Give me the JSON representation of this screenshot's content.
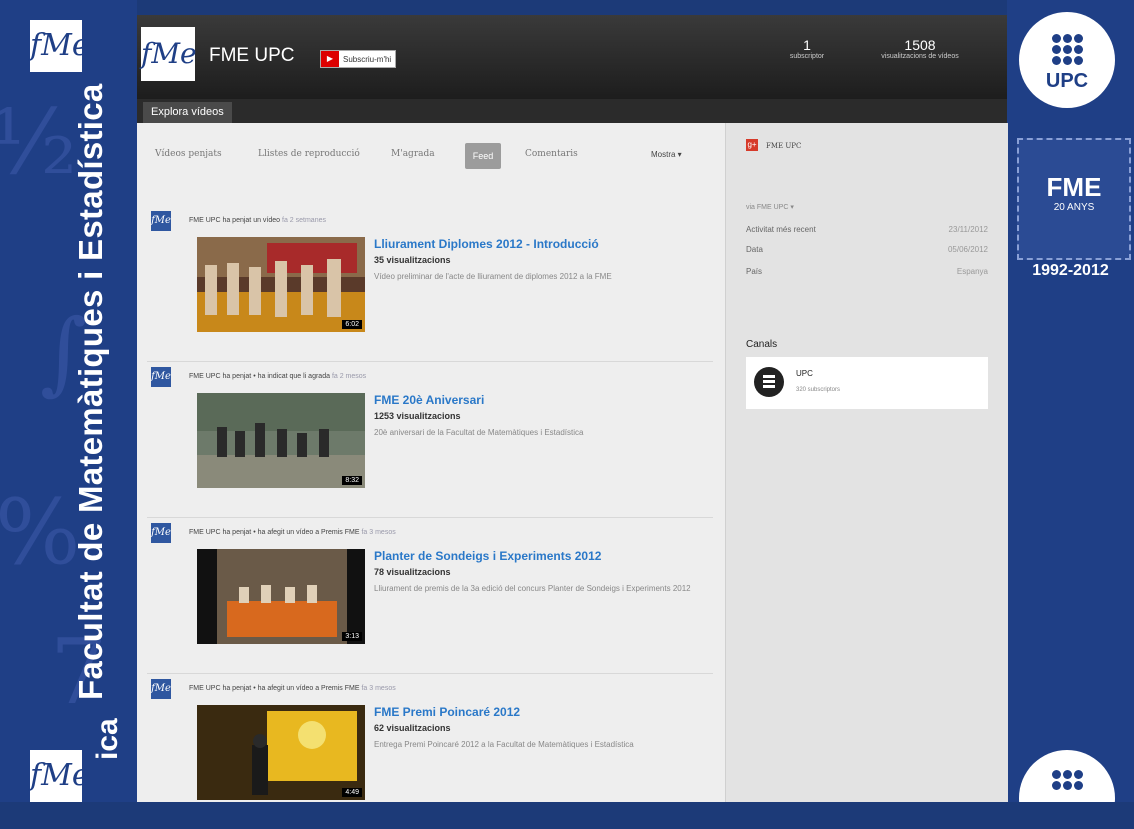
{
  "left_banner": {
    "logo_text": "fMe",
    "vertical_title": "Facultat de Matemàtiques i Estadística",
    "bottom_fragment": "ica"
  },
  "right_banner": {
    "upc_label": "UPC",
    "fme20_title": "FME",
    "fme20_sub": "20 ANYS",
    "years": "1992-2012"
  },
  "header": {
    "logo_text": "fMe",
    "channel_name": "FME UPC",
    "subscribe_label": "Subscriu-m'hi",
    "stats": [
      {
        "num": "1",
        "label": "subscriptor"
      },
      {
        "num": "1508",
        "label": "visualitzacions de vídeos"
      }
    ]
  },
  "tabs": {
    "explore": "Explora vídeos"
  },
  "subnav": {
    "items": [
      "Vídeos penjats",
      "Llistes de reproducció",
      "M'agrada",
      "Feed",
      "Comentaris"
    ],
    "show_label": "Mostra ▾"
  },
  "feed": [
    {
      "activity": "FME UPC ha penjat un vídeo",
      "ago": "fa 2 setmanes",
      "title": "Lliurament Diplomes 2012 - Introducció",
      "views": "35 visualitzacions",
      "desc": "Vídeo preliminar de l'acte de lliurament de diplomes 2012 a la FME",
      "duration": "6:02"
    },
    {
      "activity": "FME UPC ha penjat • ha indicat que li agrada",
      "ago": "fa 2 mesos",
      "title": "FME 20è Aniversari",
      "views": "1253 visualitzacions",
      "desc": "20è aniversari de la Facultat de Matemàtiques i Estadística",
      "duration": "8:32"
    },
    {
      "activity": "FME UPC ha penjat • ha afegit un vídeo a Premis FME",
      "ago": "fa 3 mesos",
      "title": "Planter de Sondeigs i Experiments 2012",
      "views": "78 visualitzacions",
      "desc": "Lliurament de premis de la 3a edició del concurs Planter de Sondeigs i Experiments 2012",
      "duration": "3:13"
    },
    {
      "activity": "FME UPC ha penjat • ha afegit un vídeo a Premis FME",
      "ago": "fa 3 mesos",
      "title": "FME Premi Poincaré 2012",
      "views": "62 visualitzacions",
      "desc": "Entrega Premi Poincaré 2012 a la Facultat de Matemàtiques i Estadística",
      "duration": "4:49"
    }
  ],
  "side": {
    "gplus_name": "FME UPC",
    "via": "via FME UPC ▾",
    "rows": [
      {
        "label": "Activitat més recent",
        "value": "23/11/2012"
      },
      {
        "label": "Data",
        "value": "05/06/2012"
      },
      {
        "label": "País",
        "value": "Espanya"
      }
    ],
    "canals_heading": "Canals",
    "canal": {
      "name": "UPC",
      "subs": "320 subscriptors"
    }
  }
}
